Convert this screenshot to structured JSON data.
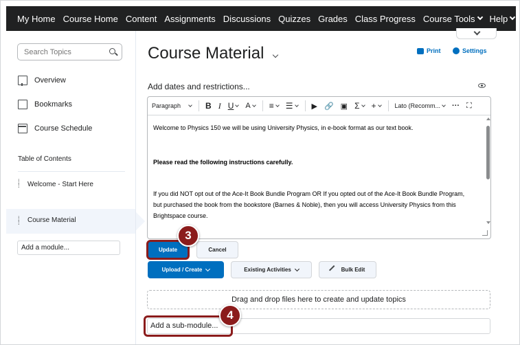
{
  "nav": {
    "items": [
      "My Home",
      "Course Home",
      "Content",
      "Assignments",
      "Discussions",
      "Quizzes",
      "Grades",
      "Class Progress",
      "Course Tools",
      "Help"
    ]
  },
  "sidebar": {
    "search_placeholder": "Search Topics",
    "links": [
      "Overview",
      "Bookmarks",
      "Course Schedule"
    ],
    "toc_label": "Table of Contents",
    "toc_items": [
      "Welcome - Start Here",
      "Course Material"
    ],
    "add_module": "Add a module..."
  },
  "main": {
    "title": "Course Material",
    "print_label": "Print",
    "settings_label": "Settings",
    "dates_label": "Add dates and restrictions...",
    "editor": {
      "toolbar": {
        "paragraph": "Paragraph",
        "bold": "B",
        "italic": "I",
        "underline": "U",
        "font": "Lato (Recomm..."
      },
      "lines": [
        "Welcome to Physics 150 we will be using University Physics, in e-book format as our text book.",
        "Please read the following instructions carefully.",
        "If you did NOT opt out of the Ace-It Book Bundle Program OR If you opted out of the Ace-It Book Bundle Program,",
        "but purchased the book from the bookstore (Barnes & Noble), then you will access University Physics from this",
        "Brightspace course."
      ]
    },
    "buttons": {
      "update": "Update",
      "cancel": "Cancel",
      "upload_create": "Upload / Create",
      "existing_activities": "Existing Activities",
      "bulk_edit": "Bulk Edit"
    },
    "dropzone": "Drag and drop files here to create and update topics",
    "submodule_placeholder": "Add a sub-module..."
  },
  "callouts": [
    "3",
    "4"
  ],
  "colors": {
    "nav_bg": "#202122",
    "primary": "#006fbf",
    "callout": "#8b1c1c"
  }
}
